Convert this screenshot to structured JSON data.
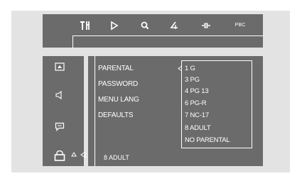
{
  "toolbar": {
    "icons": [
      "settings-icon",
      "play-icon",
      "zoom-icon",
      "angle-icon",
      "audio-icon"
    ],
    "pbc_label": "PBC"
  },
  "sidebar": {
    "icons": [
      "picture-icon",
      "speaker-icon",
      "subtitle-icon",
      "lock-icon"
    ]
  },
  "menu": {
    "items": [
      "PARENTAL",
      "PASSWORD",
      "MENU LANG",
      "DEFAULTS"
    ]
  },
  "submenu": {
    "options": [
      "1 G",
      "3 PG",
      "4 PG 13",
      "6 PG-R",
      "7 NC-17",
      "8 ADULT",
      "NO PARENTAL"
    ]
  },
  "status": {
    "current_value": "8 ADULT"
  },
  "colors": {
    "panel": "#6b6b6b",
    "frame": "#e3e3e3",
    "text": "#ffffff"
  }
}
